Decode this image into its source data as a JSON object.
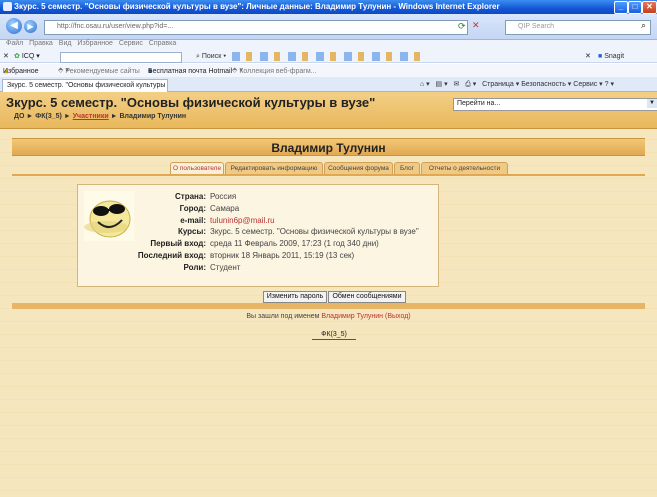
{
  "window": {
    "title": "Зкурс. 5 семестр. \"Основы физической культуры в вузе\": Личные данные: Владимир Тулунин - Windows Internet Explorer",
    "address": "http://fnc.osau.ru/user/view.php?id=...",
    "search_placeholder": "QIP Search"
  },
  "menu": [
    "Файл",
    "Правка",
    "Вид",
    "Избранное",
    "Сервис",
    "Справка"
  ],
  "toolbar": {
    "icq": "ICQ",
    "search_btn": "Поиск",
    "snagit": "Snagit"
  },
  "favorites": {
    "label": "Избранное",
    "items": [
      "Рекомендуемые сайты",
      "Бесплатная почта Hotmail",
      "Коллекция веб-фрагм..."
    ]
  },
  "browser_tab": {
    "label": "Зкурс. 5 семестр. \"Основы физической культуры ...\""
  },
  "command_bar": "Страница ▾  Безопасность ▾  Сервис ▾",
  "header": {
    "course_title": "Зкурс. 5 семестр. \"Основы физической культуры в вузе\"",
    "breadcrumb_root": "ДО",
    "breadcrumb_course": "ФК(3_5)",
    "breadcrumb_participants": "Участники",
    "breadcrumb_current": "Владимир Тулунин",
    "jump_label": "Перейти на..."
  },
  "profile": {
    "name": "Владимир Тулунин",
    "tabs": [
      "О пользователе",
      "Редактировать информацию",
      "Сообщения форума",
      "Блог",
      "Отчеты о деятельности"
    ],
    "fields": [
      {
        "label": "Страна:",
        "value": "Россия"
      },
      {
        "label": "Город:",
        "value": "Самара"
      },
      {
        "label": "e-mail:",
        "value": "tulunin6p@mail.ru",
        "link": true
      },
      {
        "label": "Курсы:",
        "value": "Зкурс. 5 семестр. \"Основы физической культуры в вузе\""
      },
      {
        "label": "Первый вход:",
        "value": "среда 11 Февраль 2009, 17:23  (1 год 340 дни)"
      },
      {
        "label": "Последний вход:",
        "value": "вторник 18 Январь 2011, 15:19  (13 сек)"
      },
      {
        "label": "Роли:",
        "value": "Студент"
      }
    ],
    "change_password": "Изменить пароль",
    "messaging": "Обмен сообщениями"
  },
  "footer": {
    "logged_in_prefix": "Вы зашли под именем",
    "logged_in_user": "Владимир Тулунин",
    "logout": "(Выход)",
    "course_button": "ФК(3_5)"
  },
  "colors": {
    "band": "#e8b85c",
    "page_bg": "#f6e6bd",
    "link": "#b33333"
  }
}
